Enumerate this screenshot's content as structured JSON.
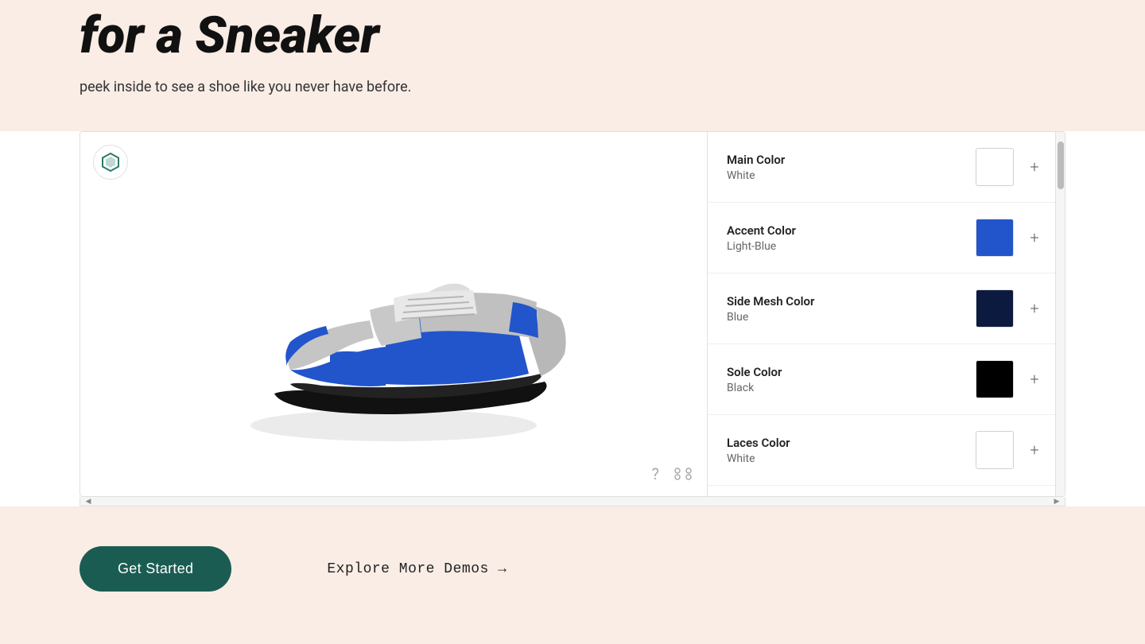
{
  "page": {
    "background_color": "#f9ede6"
  },
  "header": {
    "headline": "for a Sneaker",
    "subtitle": "peek inside to see a shoe like you never have before."
  },
  "color_options": [
    {
      "id": "main-color",
      "label": "Main Color",
      "value": "White",
      "swatch_class": "white-swatch",
      "plus_label": "+"
    },
    {
      "id": "accent-color",
      "label": "Accent Color",
      "value": "Light-Blue",
      "swatch_class": "blue-accent",
      "plus_label": "+"
    },
    {
      "id": "side-mesh-color",
      "label": "Side Mesh Color",
      "value": "Blue",
      "swatch_class": "dark-blue",
      "plus_label": "+"
    },
    {
      "id": "sole-color",
      "label": "Sole Color",
      "value": "Black",
      "swatch_class": "black-swatch",
      "plus_label": "+"
    },
    {
      "id": "laces-color",
      "label": "Laces Color",
      "value": "White",
      "swatch_class": "white-laces",
      "plus_label": "+"
    }
  ],
  "controls": {
    "help_icon": "?",
    "expand_icon": "⊞"
  },
  "bottom": {
    "get_started_label": "Get Started",
    "explore_label": "Explore More Demos →"
  },
  "logo": {
    "symbol": "⬡"
  }
}
